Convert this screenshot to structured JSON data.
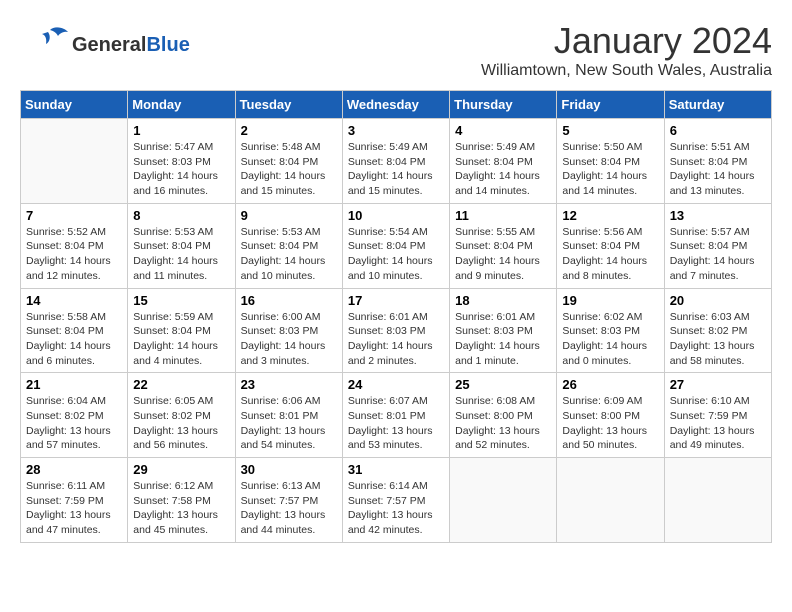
{
  "header": {
    "logo_general": "General",
    "logo_blue": "Blue",
    "title": "January 2024",
    "subtitle": "Williamtown, New South Wales, Australia"
  },
  "days_of_week": [
    "Sunday",
    "Monday",
    "Tuesday",
    "Wednesday",
    "Thursday",
    "Friday",
    "Saturday"
  ],
  "weeks": [
    [
      {
        "day": "",
        "info": ""
      },
      {
        "day": "1",
        "info": "Sunrise: 5:47 AM\nSunset: 8:03 PM\nDaylight: 14 hours\nand 16 minutes."
      },
      {
        "day": "2",
        "info": "Sunrise: 5:48 AM\nSunset: 8:04 PM\nDaylight: 14 hours\nand 15 minutes."
      },
      {
        "day": "3",
        "info": "Sunrise: 5:49 AM\nSunset: 8:04 PM\nDaylight: 14 hours\nand 15 minutes."
      },
      {
        "day": "4",
        "info": "Sunrise: 5:49 AM\nSunset: 8:04 PM\nDaylight: 14 hours\nand 14 minutes."
      },
      {
        "day": "5",
        "info": "Sunrise: 5:50 AM\nSunset: 8:04 PM\nDaylight: 14 hours\nand 14 minutes."
      },
      {
        "day": "6",
        "info": "Sunrise: 5:51 AM\nSunset: 8:04 PM\nDaylight: 14 hours\nand 13 minutes."
      }
    ],
    [
      {
        "day": "7",
        "info": "Sunrise: 5:52 AM\nSunset: 8:04 PM\nDaylight: 14 hours\nand 12 minutes."
      },
      {
        "day": "8",
        "info": "Sunrise: 5:53 AM\nSunset: 8:04 PM\nDaylight: 14 hours\nand 11 minutes."
      },
      {
        "day": "9",
        "info": "Sunrise: 5:53 AM\nSunset: 8:04 PM\nDaylight: 14 hours\nand 10 minutes."
      },
      {
        "day": "10",
        "info": "Sunrise: 5:54 AM\nSunset: 8:04 PM\nDaylight: 14 hours\nand 10 minutes."
      },
      {
        "day": "11",
        "info": "Sunrise: 5:55 AM\nSunset: 8:04 PM\nDaylight: 14 hours\nand 9 minutes."
      },
      {
        "day": "12",
        "info": "Sunrise: 5:56 AM\nSunset: 8:04 PM\nDaylight: 14 hours\nand 8 minutes."
      },
      {
        "day": "13",
        "info": "Sunrise: 5:57 AM\nSunset: 8:04 PM\nDaylight: 14 hours\nand 7 minutes."
      }
    ],
    [
      {
        "day": "14",
        "info": "Sunrise: 5:58 AM\nSunset: 8:04 PM\nDaylight: 14 hours\nand 6 minutes."
      },
      {
        "day": "15",
        "info": "Sunrise: 5:59 AM\nSunset: 8:04 PM\nDaylight: 14 hours\nand 4 minutes."
      },
      {
        "day": "16",
        "info": "Sunrise: 6:00 AM\nSunset: 8:03 PM\nDaylight: 14 hours\nand 3 minutes."
      },
      {
        "day": "17",
        "info": "Sunrise: 6:01 AM\nSunset: 8:03 PM\nDaylight: 14 hours\nand 2 minutes."
      },
      {
        "day": "18",
        "info": "Sunrise: 6:01 AM\nSunset: 8:03 PM\nDaylight: 14 hours\nand 1 minute."
      },
      {
        "day": "19",
        "info": "Sunrise: 6:02 AM\nSunset: 8:03 PM\nDaylight: 14 hours\nand 0 minutes."
      },
      {
        "day": "20",
        "info": "Sunrise: 6:03 AM\nSunset: 8:02 PM\nDaylight: 13 hours\nand 58 minutes."
      }
    ],
    [
      {
        "day": "21",
        "info": "Sunrise: 6:04 AM\nSunset: 8:02 PM\nDaylight: 13 hours\nand 57 minutes."
      },
      {
        "day": "22",
        "info": "Sunrise: 6:05 AM\nSunset: 8:02 PM\nDaylight: 13 hours\nand 56 minutes."
      },
      {
        "day": "23",
        "info": "Sunrise: 6:06 AM\nSunset: 8:01 PM\nDaylight: 13 hours\nand 54 minutes."
      },
      {
        "day": "24",
        "info": "Sunrise: 6:07 AM\nSunset: 8:01 PM\nDaylight: 13 hours\nand 53 minutes."
      },
      {
        "day": "25",
        "info": "Sunrise: 6:08 AM\nSunset: 8:00 PM\nDaylight: 13 hours\nand 52 minutes."
      },
      {
        "day": "26",
        "info": "Sunrise: 6:09 AM\nSunset: 8:00 PM\nDaylight: 13 hours\nand 50 minutes."
      },
      {
        "day": "27",
        "info": "Sunrise: 6:10 AM\nSunset: 7:59 PM\nDaylight: 13 hours\nand 49 minutes."
      }
    ],
    [
      {
        "day": "28",
        "info": "Sunrise: 6:11 AM\nSunset: 7:59 PM\nDaylight: 13 hours\nand 47 minutes."
      },
      {
        "day": "29",
        "info": "Sunrise: 6:12 AM\nSunset: 7:58 PM\nDaylight: 13 hours\nand 45 minutes."
      },
      {
        "day": "30",
        "info": "Sunrise: 6:13 AM\nSunset: 7:57 PM\nDaylight: 13 hours\nand 44 minutes."
      },
      {
        "day": "31",
        "info": "Sunrise: 6:14 AM\nSunset: 7:57 PM\nDaylight: 13 hours\nand 42 minutes."
      },
      {
        "day": "",
        "info": ""
      },
      {
        "day": "",
        "info": ""
      },
      {
        "day": "",
        "info": ""
      }
    ]
  ]
}
